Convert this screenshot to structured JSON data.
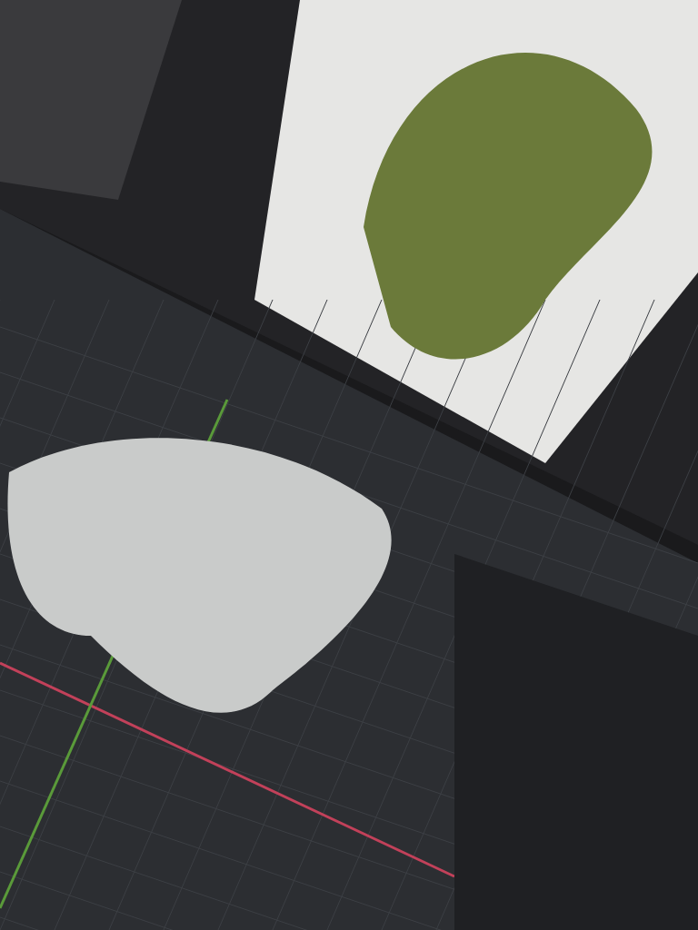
{
  "photo": {
    "kind": "photo"
  }
}
